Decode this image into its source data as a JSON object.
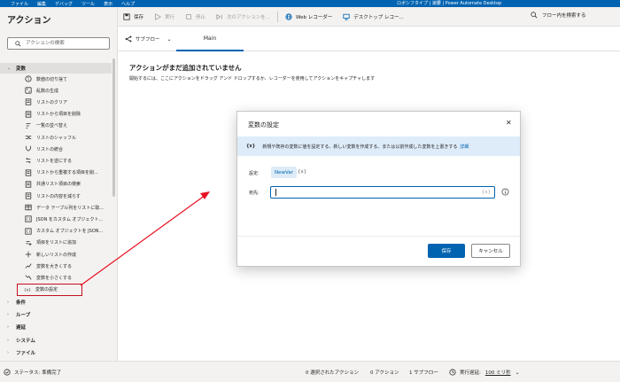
{
  "titlebar": {
    "menu": [
      "ファイル",
      "編集",
      "デバッグ",
      "ツール",
      "表示",
      "ヘルプ"
    ],
    "title": "ロボシフタイプ | 速腰 | Power Automate Desktop"
  },
  "left_panel": {
    "heading": "アクション",
    "search_placeholder": "アクションの検索",
    "category_open": "変数",
    "items": [
      {
        "label": "数値の切り捨て",
        "icon": "number-icon"
      },
      {
        "label": "乱数の生成",
        "icon": "dice-icon"
      },
      {
        "label": "リストのクリア",
        "icon": "list-icon"
      },
      {
        "label": "リストから項目を削除",
        "icon": "list-icon"
      },
      {
        "label": "一覧の並べ替え",
        "icon": "sort-icon"
      },
      {
        "label": "リストのシャッフル",
        "icon": "shuffle-icon"
      },
      {
        "label": "リストの統合",
        "icon": "merge-icon"
      },
      {
        "label": "リストを逆にする",
        "icon": "reverse-icon"
      },
      {
        "label": "リストから重複する項目を削...",
        "icon": "list-icon"
      },
      {
        "label": "共通リスト項目の検索",
        "icon": "list-icon"
      },
      {
        "label": "リストの内容を減らす",
        "icon": "list-icon"
      },
      {
        "label": "データ テーブル列をリストに取...",
        "icon": "table-icon"
      },
      {
        "label": "JSON をカスタム オブジェクト...",
        "icon": "json-icon"
      },
      {
        "label": "カスタム オブジェクトを JSON...",
        "icon": "json-icon"
      },
      {
        "label": "項目をリストに追加",
        "icon": "add-icon"
      },
      {
        "label": "新しいリストの作成",
        "icon": "plus-icon"
      },
      {
        "label": "変数を大きくする",
        "icon": "increase-icon"
      },
      {
        "label": "変数を小さくする",
        "icon": "decrease-icon"
      },
      {
        "label": "変数の設定",
        "icon": "variable-icon"
      }
    ],
    "categories_closed": [
      "条件",
      "ループ",
      "遅延",
      "システム",
      "ファイル"
    ]
  },
  "toolbar": {
    "save": "保存",
    "run": "実行",
    "stop": "停止",
    "next": "次のアクションを...",
    "web_recorder": "Web レコーダー",
    "desktop_recorder": "デスクトップ レコー...",
    "search_flow": "フロー内を検索する"
  },
  "tabs": {
    "subflow": "サブフロー",
    "main": "Main"
  },
  "canvas": {
    "empty_title": "アクションがまだ追加されていません",
    "empty_desc": "開始するには、ここにアクションをドラッグ アンド ドロップするか、レコーダーを使用してアクションをキャプチャします"
  },
  "dialog": {
    "title": "変数の設定",
    "info_text": "新規や既存の変数に値を設定する、新しい変数を作成する、または以前作成した変数を上書きする",
    "info_link": "詳細",
    "info_prefix": "{x}",
    "set_label": "設定:",
    "var_name": "NewVar",
    "var_suffix": "{x}",
    "to_label": "宛先:",
    "to_value": "",
    "fx_hint": "{x}",
    "save": "保存",
    "cancel": "キャンセル"
  },
  "status": {
    "state": "ステータス: 準備完了",
    "selected": "0 選択されたアクション",
    "actions": "0 アクション",
    "subflows": "1 サブフロー",
    "delay_label": "実行遅延:",
    "delay_value": "100 ミリ秒"
  },
  "colors": {
    "accent": "#0063b1",
    "annotation": "#e81123"
  }
}
